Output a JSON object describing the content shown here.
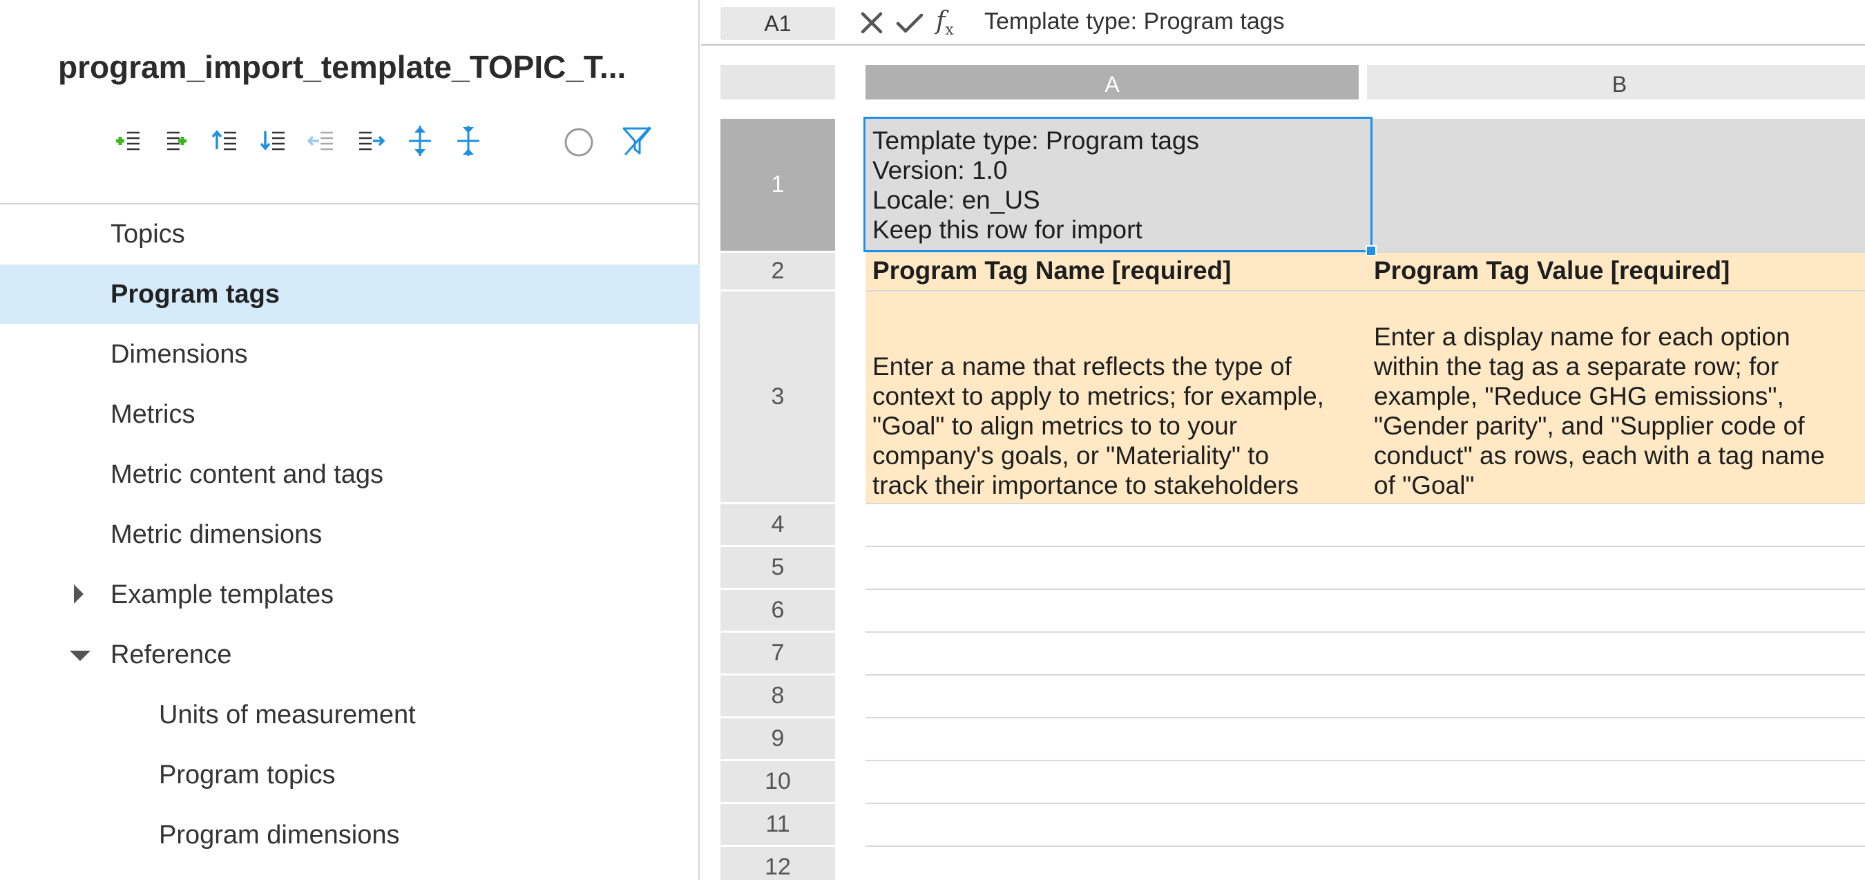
{
  "sidebar": {
    "title": "program_import_template_TOPIC_T...",
    "toolbar": [
      {
        "icon": "add-row-above-icon",
        "color": "#3cb41e"
      },
      {
        "icon": "add-row-below-icon",
        "color": "#3cb41e"
      },
      {
        "icon": "move-up-icon",
        "color": "#1e8fe0"
      },
      {
        "icon": "move-down-icon",
        "color": "#1e8fe0"
      },
      {
        "icon": "outdent-icon",
        "color": "#9ccbf0"
      },
      {
        "icon": "indent-icon",
        "color": "#1e8fe0"
      },
      {
        "icon": "expand-all-icon",
        "color": "#1e8fe0"
      },
      {
        "icon": "collapse-all-icon",
        "color": "#1e8fe0"
      },
      {
        "icon": "circle-icon",
        "color": "#999999"
      },
      {
        "icon": "clear-filter-icon",
        "color": "#1e8fe0"
      }
    ],
    "items": [
      {
        "label": "Topics",
        "level": 1
      },
      {
        "label": "Program tags",
        "level": 1,
        "active": true
      },
      {
        "label": "Dimensions",
        "level": 1
      },
      {
        "label": "Metrics",
        "level": 1
      },
      {
        "label": "Metric content and tags",
        "level": 1
      },
      {
        "label": "Metric dimensions",
        "level": 1
      },
      {
        "label": "Example templates",
        "level": 1,
        "caret": "collapsed"
      },
      {
        "label": "Reference",
        "level": 1,
        "caret": "expanded"
      },
      {
        "label": "Units of measurement",
        "level": 2
      },
      {
        "label": "Program topics",
        "level": 2
      },
      {
        "label": "Program dimensions",
        "level": 2
      }
    ]
  },
  "formula_bar": {
    "cell_ref": "A1",
    "cancel_icon": "close-icon",
    "confirm_icon": "checkmark-icon",
    "function_icon": "fx-icon",
    "value": "Template type: Program tags"
  },
  "grid": {
    "columns": [
      {
        "label": "A",
        "selected": true
      },
      {
        "label": "B",
        "selected": false
      }
    ],
    "rows": [
      {
        "num": "1",
        "selected": true,
        "style": "meta",
        "cells": [
          [
            "Template type: Program tags",
            "Version: 1.0",
            "Locale: en_US",
            "Keep this row for import"
          ],
          []
        ]
      },
      {
        "num": "2",
        "style": "hdr",
        "cells": [
          [
            "Program Tag Name [required]"
          ],
          [
            "Program Tag Value [required]"
          ]
        ]
      },
      {
        "num": "3",
        "style": "desc",
        "cells": [
          [
            "Enter a name that reflects the type of",
            "context to apply to metrics; for example,",
            "\"Goal\" to align metrics to to your",
            "company's goals, or \"Materiality\" to",
            "track their importance to stakeholders"
          ],
          [
            "Enter a display name for each option",
            "within the tag as a separate row; for",
            "example, \"Reduce GHG emissions\",",
            "\"Gender parity\", and \"Supplier code of",
            "conduct\" as rows, each with a tag name",
            "of \"Goal\""
          ]
        ]
      },
      {
        "num": "4",
        "style": "empty",
        "cells": [
          [],
          []
        ]
      },
      {
        "num": "5",
        "style": "empty",
        "cells": [
          [],
          []
        ]
      },
      {
        "num": "6",
        "style": "empty",
        "cells": [
          [],
          []
        ]
      },
      {
        "num": "7",
        "style": "empty",
        "cells": [
          [],
          []
        ]
      },
      {
        "num": "8",
        "style": "empty",
        "cells": [
          [],
          []
        ]
      },
      {
        "num": "9",
        "style": "empty",
        "cells": [
          [],
          []
        ]
      },
      {
        "num": "10",
        "style": "empty",
        "cells": [
          [],
          []
        ]
      },
      {
        "num": "11",
        "style": "empty",
        "cells": [
          [],
          []
        ]
      },
      {
        "num": "12",
        "style": "empty",
        "cells": [
          [],
          []
        ]
      }
    ],
    "selection": "A1",
    "colors": {
      "header_fill": "#ffe9c5",
      "meta_fill": "#dcdcdc",
      "selection": "#1e90ea",
      "active_item": "#d5ebfa"
    }
  }
}
